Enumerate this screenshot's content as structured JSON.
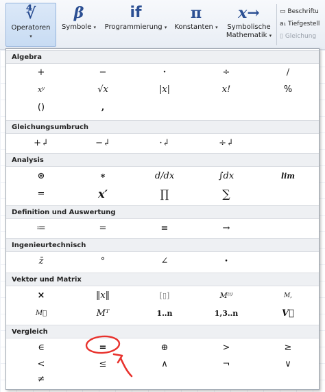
{
  "ribbon": {
    "buttons": [
      {
        "glyph": "∜",
        "label": "Operatoren",
        "caret": "▾"
      },
      {
        "glyph": "β",
        "label": "Symbole",
        "caret": "▾"
      },
      {
        "glyph": "if",
        "label": "Programmierung",
        "caret": "▾"
      },
      {
        "glyph": "π",
        "label": "Konstanten",
        "caret": "▾"
      },
      {
        "glyph": "x→",
        "label": "Symbolische",
        "label2": "Mathematik",
        "caret": "▾"
      }
    ],
    "side": {
      "label_button": "Beschriftu",
      "subscript_button": "Tiefgestell",
      "subscript_prefix": "a₁",
      "equation_button": "Gleichung"
    }
  },
  "panel": {
    "sections": [
      {
        "title": "Algebra",
        "rows": [
          [
            "+",
            "−",
            "·",
            "÷",
            "/"
          ],
          [
            "xʸ",
            "√x",
            "|x|",
            "x!",
            "%"
          ],
          [
            "()",
            ","
          ]
        ]
      },
      {
        "title": "Gleichungsumbruch",
        "rows": [
          [
            "+↲",
            "−↲",
            "·↲",
            "÷↲"
          ]
        ]
      },
      {
        "title": "Analysis",
        "rows": [
          [
            "⊛",
            "∗",
            "d/dx",
            "∫dx",
            "lim"
          ],
          [
            "=",
            "x′",
            "∏",
            "∑"
          ]
        ]
      },
      {
        "title": "Definition und Auswertung",
        "rows": [
          [
            "≔",
            "=",
            "≡",
            "→"
          ]
        ]
      },
      {
        "title": "Ingenieurtechnisch",
        "rows": [
          [
            "z̄",
            "°",
            "∠",
            "•"
          ]
        ]
      },
      {
        "title": "Vektor und Matrix",
        "rows": [
          [
            "×",
            "‖x‖",
            "[▯]",
            "M⁽ⁱ⁾",
            "M,"
          ],
          [
            "M⃡",
            "Mᵀ",
            "1‥n",
            "1,3‥n",
            "V⃗"
          ]
        ]
      },
      {
        "title": "Vergleich",
        "rows": [
          [
            "∈",
            "=",
            "⊕",
            ">",
            "≥"
          ],
          [
            "<",
            "≤",
            "∧",
            "¬",
            "∨"
          ],
          [
            "≠"
          ]
        ]
      }
    ]
  }
}
